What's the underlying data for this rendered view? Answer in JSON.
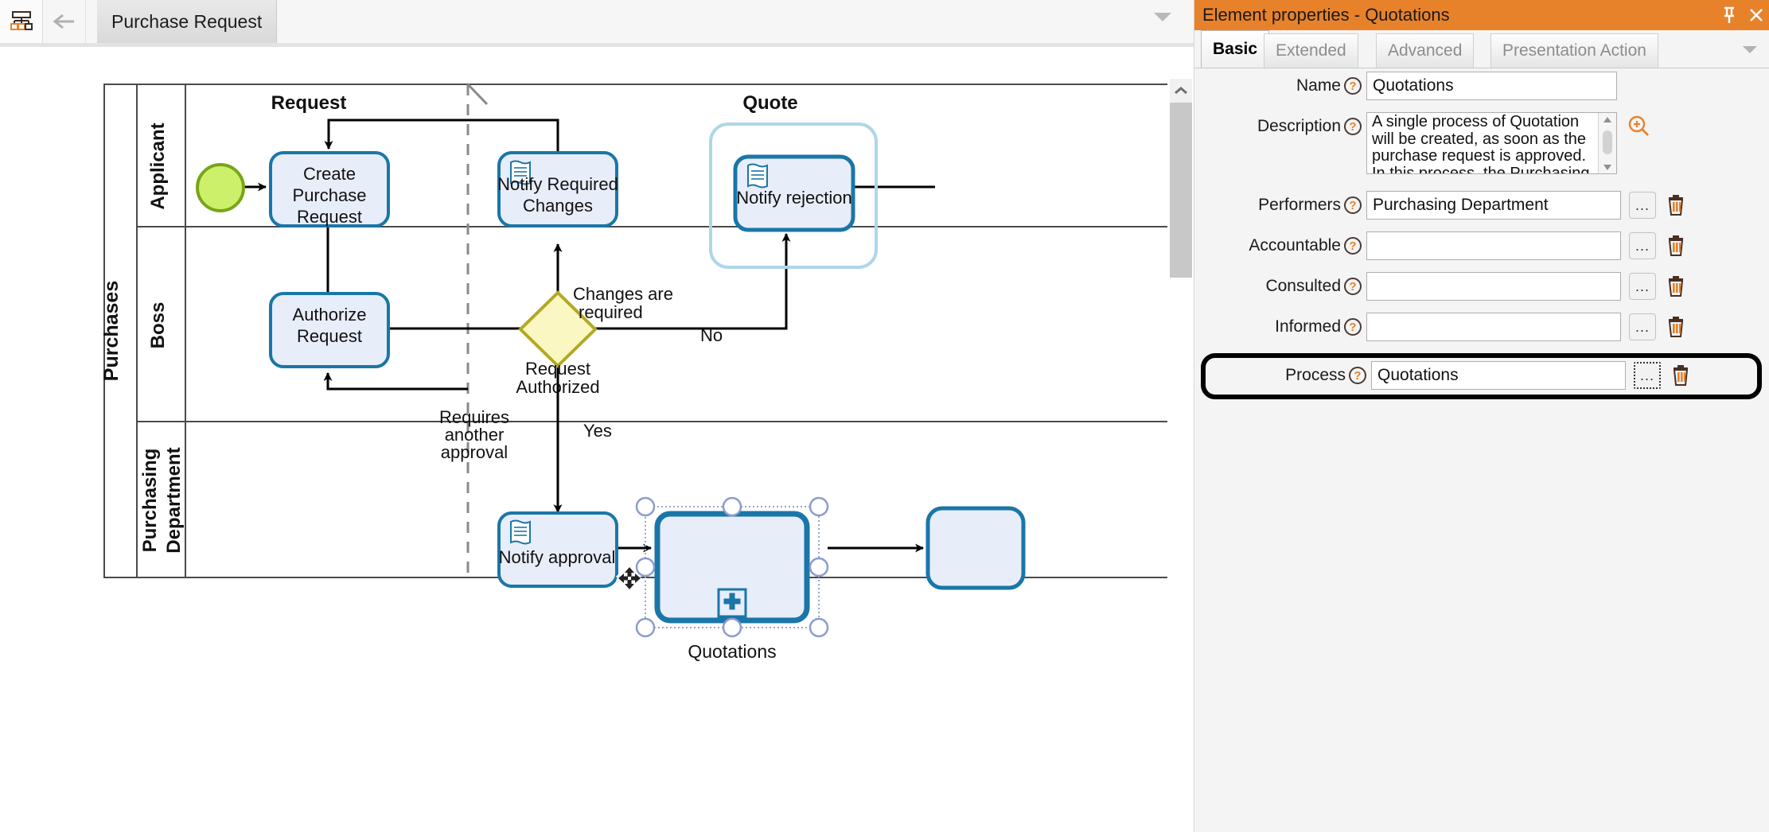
{
  "editor": {
    "toolbar": {
      "model_tree_icon": "model-tree-icon",
      "back_icon": "back-arrow-icon",
      "overflow_icon": "chevron-down-icon"
    },
    "tab": {
      "label": "Purchase Request"
    },
    "scrollbar": {
      "up_icon": "chevron-up-icon"
    }
  },
  "diagram": {
    "pool": {
      "label": "Purchases"
    },
    "lanes": [
      {
        "label": "Applicant"
      },
      {
        "label": "Boss"
      },
      {
        "label": "Purchasing Department"
      }
    ],
    "milestones": [
      {
        "label": "Request"
      },
      {
        "label": "Quote"
      }
    ],
    "nodes": [
      {
        "id": "start",
        "type": "start-event",
        "label": ""
      },
      {
        "id": "create-purchase-request",
        "type": "task",
        "label": "Create\nPurchase\nRequest"
      },
      {
        "id": "notify-required-changes",
        "type": "script-task",
        "label": "Notify Required\nChanges"
      },
      {
        "id": "notify-rejection",
        "type": "script-task",
        "label": "Notify rejection"
      },
      {
        "id": "authorize-request",
        "type": "task",
        "label": "Authorize\nRequest"
      },
      {
        "id": "gateway-authorized",
        "type": "exclusive-gateway",
        "label": ""
      },
      {
        "id": "notify-approval",
        "type": "script-task",
        "label": "Notify approval"
      },
      {
        "id": "quotations",
        "type": "collapsed-subprocess",
        "label": "Quotations",
        "selected": true
      }
    ],
    "flow_labels": [
      {
        "text": "Changes are\nrequired"
      },
      {
        "text": "No"
      },
      {
        "text": "Request\nAuthorized"
      },
      {
        "text": "Yes"
      },
      {
        "text": "Requires\nanother\napproval"
      }
    ],
    "colors": {
      "task_fill": "#e8edfa",
      "task_stroke": "#1a76a8",
      "start_fill": "#cdf06a",
      "start_stroke": "#78a518",
      "gateway_fill": "#fbf7c3",
      "gateway_stroke": "#b3a920",
      "group_stroke": "#aed6e8",
      "selection_handle": "#8c9ccc"
    }
  },
  "properties": {
    "title": "Element properties - Quotations",
    "pin_icon": "pin-icon",
    "close_icon": "close-icon",
    "tabs": [
      {
        "label": "Basic",
        "active": true
      },
      {
        "label": "Extended",
        "active": false
      },
      {
        "label": "Advanced",
        "active": false
      },
      {
        "label": "Presentation Action",
        "active": false
      }
    ],
    "tabs_overflow_icon": "chevron-down-icon",
    "fields": [
      {
        "key": "name",
        "label": "Name",
        "value": "Quotations",
        "help_icon": "question-icon"
      },
      {
        "key": "description",
        "label": "Description",
        "value": "A single process of Quotation will be created, as soon as the purchase request is approved. In this process, the Purchasing",
        "help_icon": "question-icon"
      },
      {
        "key": "performers",
        "label": "Performers",
        "value": "Purchasing Department",
        "help_icon": "question-icon"
      },
      {
        "key": "accountable",
        "label": "Accountable",
        "value": "",
        "help_icon": "question-icon"
      },
      {
        "key": "consulted",
        "label": "Consulted",
        "value": "",
        "help_icon": "question-icon"
      },
      {
        "key": "informed",
        "label": "Informed",
        "value": "",
        "help_icon": "question-icon"
      },
      {
        "key": "process",
        "label": "Process",
        "value": "Quotations",
        "help_icon": "question-icon",
        "highlighted": true
      }
    ],
    "buttons": {
      "browse_label": "...",
      "delete_icon": "trash-icon",
      "zoom_icon": "zoom-in-icon"
    },
    "accent_color": "#e8822a"
  }
}
